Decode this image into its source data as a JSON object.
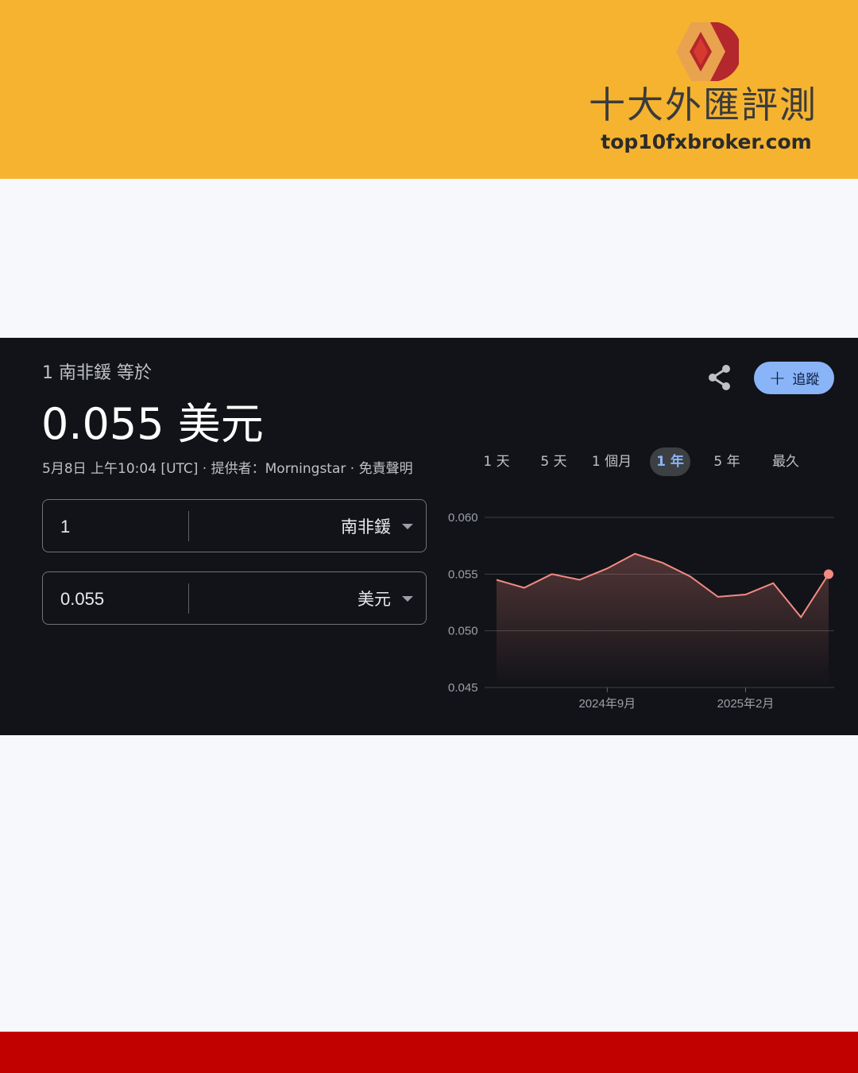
{
  "banner": {
    "brand_name": "十大外匯評測",
    "brand_url": "top10fxbroker.com",
    "colors": {
      "background": "#f5b330",
      "logo_red": "#b3272d",
      "logo_orange": "#e9a24e",
      "footer": "#c10000"
    }
  },
  "widget": {
    "subtitle": "1 南非鍰 等於",
    "value_text": "0.055 美元",
    "meta": {
      "timestamp": "5月8日 上午10:04 [UTC]",
      "separator": " · ",
      "provider": "提供者：Morningstar",
      "disclaimer": "免責聲明"
    },
    "follow_label": "追蹤",
    "share_icon": "share-icon",
    "tabs": [
      {
        "label": "1 天",
        "active": false
      },
      {
        "label": "5 天",
        "active": false
      },
      {
        "label": "1 個月",
        "active": false
      },
      {
        "label": "1 年",
        "active": true
      },
      {
        "label": "5 年",
        "active": false
      },
      {
        "label": "最久",
        "active": false
      }
    ],
    "converter": {
      "from": {
        "amount": "1",
        "currency": "南非鍰"
      },
      "to": {
        "amount": "0.055",
        "currency": "美元"
      }
    },
    "colors": {
      "background": "#121318",
      "accent": "#8ab4f8",
      "line": "#f28b82"
    }
  },
  "chart_data": {
    "type": "line",
    "title": "",
    "xlabel": "",
    "ylabel": "",
    "ylim": [
      0.045,
      0.06
    ],
    "yticks": [
      "0.060",
      "0.055",
      "0.050",
      "0.045"
    ],
    "xticks": [
      "2024年9月",
      "2025年2月"
    ],
    "grid": true,
    "x": [
      "2024-05",
      "2024-06",
      "2024-07",
      "2024-08",
      "2024-09",
      "2024-10",
      "2024-11",
      "2024-12",
      "2025-01",
      "2025-02",
      "2025-03",
      "2025-04",
      "2025-05"
    ],
    "series": [
      {
        "values": [
          0.0545,
          0.0538,
          0.055,
          0.0545,
          0.0555,
          0.0568,
          0.056,
          0.0548,
          0.053,
          0.0532,
          0.0542,
          0.0512,
          0.055
        ]
      }
    ]
  }
}
